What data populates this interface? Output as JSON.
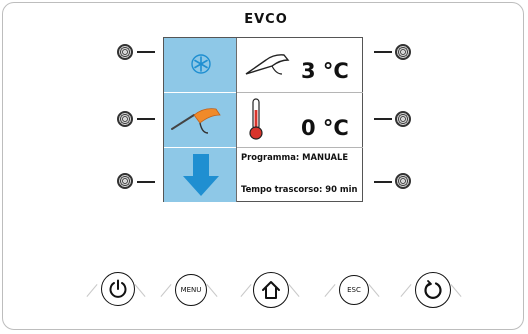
{
  "brand": {
    "logo_text": "EVCO"
  },
  "screen": {
    "row1": {
      "value": "3 °C"
    },
    "row2": {
      "value": "0 °C"
    },
    "row3": {
      "program_line": "Programma: MANUALE",
      "elapsed_line": "Tempo trascorso: 90 min"
    }
  },
  "bottom_buttons": {
    "menu_label": "MENU",
    "esc_label": "ESC"
  },
  "colors": {
    "tile_blue": "#8ec8e7",
    "icon_blue": "#1f8fd1",
    "probe_orange": "#f08a2a"
  },
  "icons": [
    "snowflake-icon",
    "probe-icon",
    "core-probe-icon",
    "thermometer-icon",
    "down-arrow-icon",
    "power-icon",
    "home-icon",
    "cycle-icon"
  ]
}
